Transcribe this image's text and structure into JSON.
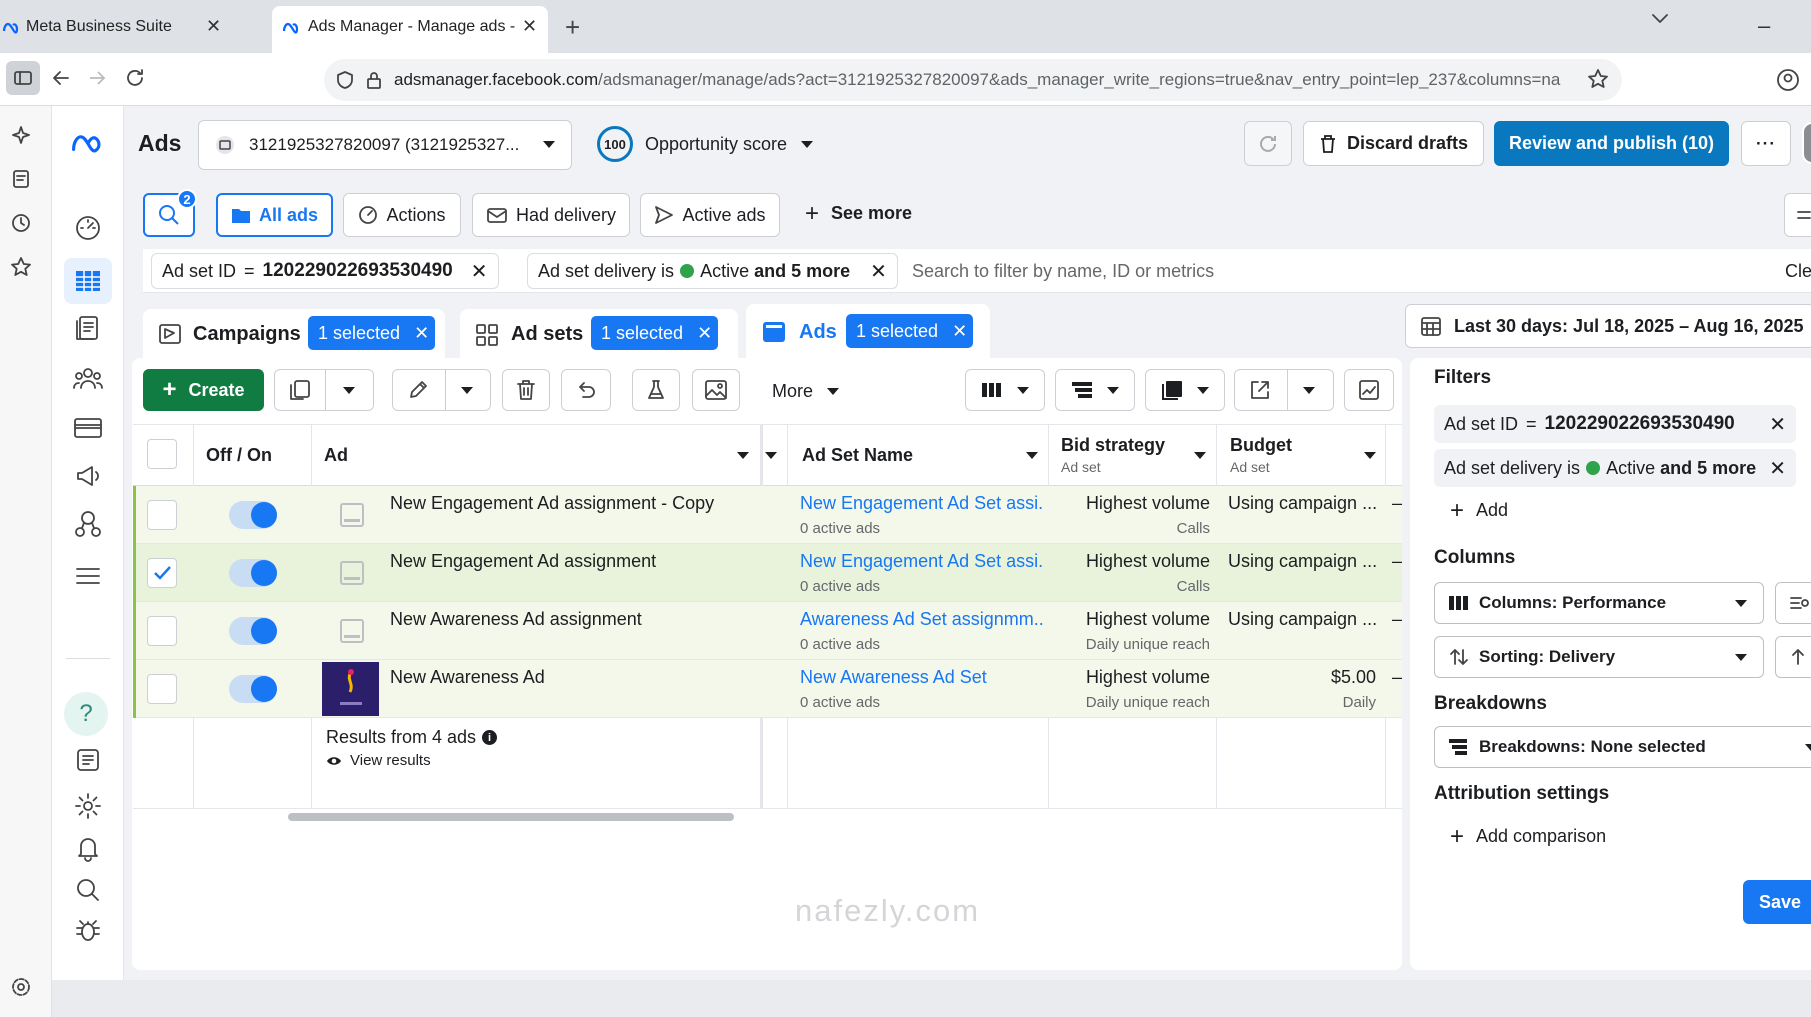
{
  "browser": {
    "tabs": [
      {
        "title": "Meta Business Suite"
      },
      {
        "title": "Ads Manager - Manage ads - A"
      }
    ],
    "url_host": "adsmanager.facebook.com",
    "url_path": "/adsmanager/manage/ads?act=3121925327820097&ads_manager_write_regions=true&nav_entry_point=lep_237&columns=na"
  },
  "header": {
    "title": "Ads",
    "account": "3121925327820097 (3121925327...",
    "opportunity_value": "100",
    "opportunity_label": "Opportunity score",
    "discard_label": "Discard drafts",
    "publish_label": "Review and publish (10)",
    "more_label": "···"
  },
  "filter_tabs": {
    "search_badge": "2",
    "all_ads": "All ads",
    "actions": "Actions",
    "had_delivery": "Had delivery",
    "active_ads": "Active ads",
    "see_more": "See more"
  },
  "active_filters": {
    "adset_id_label": "Ad set ID",
    "adset_id_op": "=",
    "adset_id_value": "120229022693530490",
    "delivery_label": "Ad set delivery is",
    "delivery_value": "Active",
    "delivery_more": "and 5 more",
    "search_placeholder": "Search to filter by name, ID or metrics",
    "clear": "Clea"
  },
  "level_tabs": {
    "campaigns": "Campaigns",
    "campaigns_selected": "1 selected",
    "adsets": "Ad sets",
    "adsets_selected": "1 selected",
    "ads": "Ads",
    "ads_selected": "1 selected"
  },
  "date_range": "Last 30 days: Jul 18, 2025 – Aug 16, 2025",
  "toolbar": {
    "create": "Create",
    "more": "More"
  },
  "table": {
    "headers": {
      "off_on": "Off / On",
      "ad": "Ad",
      "adset_name": "Ad Set Name",
      "bid_strategy": "Bid strategy",
      "bid_strategy_sub": "Ad set",
      "budget": "Budget",
      "budget_sub": "Ad set"
    },
    "rows": [
      {
        "ad": "New Engagement Ad assignment - Copy",
        "adset": "New Engagement Ad Set assi...",
        "adset_sub": "0 active ads",
        "bid": "Highest volume",
        "bid_sub": "Calls",
        "budget": "Using campaign ...",
        "budget_sub": "",
        "checked": false
      },
      {
        "ad": "New Engagement Ad assignment",
        "adset": "New Engagement Ad Set assi...",
        "adset_sub": "0 active ads",
        "bid": "Highest volume",
        "bid_sub": "Calls",
        "budget": "Using campaign ...",
        "budget_sub": "",
        "checked": true
      },
      {
        "ad": "New Awareness Ad assignment",
        "adset": "Awareness Ad Set assignmm...",
        "adset_sub": "0 active ads",
        "bid": "Highest volume",
        "bid_sub": "Daily unique reach",
        "budget": "Using campaign ...",
        "budget_sub": "",
        "checked": false
      },
      {
        "ad": "New Awareness Ad",
        "adset": "New Awareness Ad Set",
        "adset_sub": "0 active ads",
        "bid": "Highest volume",
        "bid_sub": "Daily unique reach",
        "budget": "$5.00",
        "budget_sub": "Daily",
        "checked": false
      }
    ],
    "results_label": "Results from 4 ads",
    "view_results": "View results"
  },
  "side_panel": {
    "filters_title": "Filters",
    "filter1_label": "Ad set ID",
    "filter1_op": "=",
    "filter1_value": "120229022693530490",
    "filter2_label": "Ad set delivery is",
    "filter2_value": "Active",
    "filter2_more": "and 5 more",
    "add": "Add",
    "columns_title": "Columns",
    "columns_select": "Columns: Performance",
    "sorting_select": "Sorting: Delivery",
    "breakdowns_title": "Breakdowns",
    "breakdowns_select": "Breakdowns: None selected",
    "attribution_title": "Attribution settings",
    "add_comparison": "Add comparison",
    "save": "Save"
  },
  "colors": {
    "primary_blue": "#1877f2",
    "publish_blue": "#0a78be",
    "create_green": "#107c41",
    "row_highlight": "#f3f8ea",
    "active_dot": "#31a24c"
  }
}
